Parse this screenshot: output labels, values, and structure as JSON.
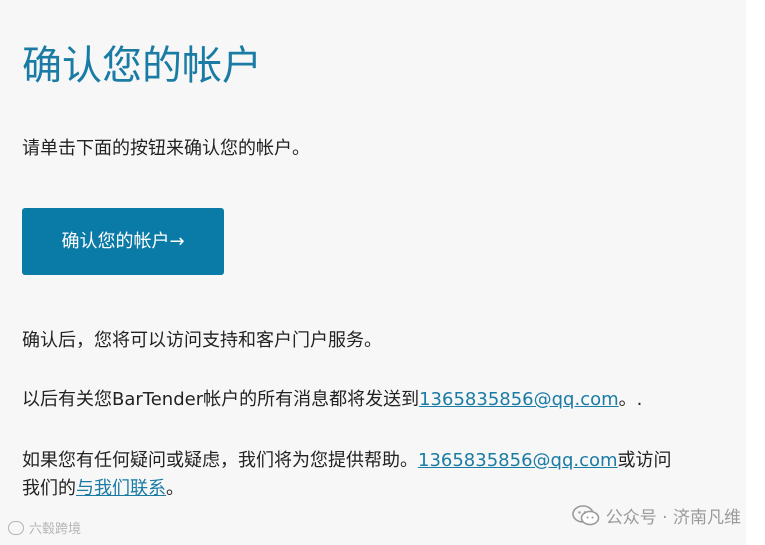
{
  "title": "确认您的帐户",
  "intro": "请单击下面的按钮来确认您的帐户。",
  "confirm_button": "确认您的帐户→",
  "after_text": "确认后，您将可以访问支持和客户门户服务。",
  "messages": {
    "prefix": "以后有关您BarTender帐户的所有消息都将发送到",
    "email": "1365835856@qq.com",
    "suffix": "。."
  },
  "help": {
    "prefix": "如果您有任何疑问或疑虑，我们将为您提供帮助。",
    "email": "1365835856@qq.com",
    "mid": "或访问",
    "line2_prefix": "我们的",
    "contact_link": "与我们联系",
    "suffix": "。"
  },
  "watermark_left": {
    "text": "六毂跨境",
    "icon": "logo-icon"
  },
  "watermark_right": {
    "text": "公众号 · 济南凡维",
    "icon": "wechat-icon"
  }
}
